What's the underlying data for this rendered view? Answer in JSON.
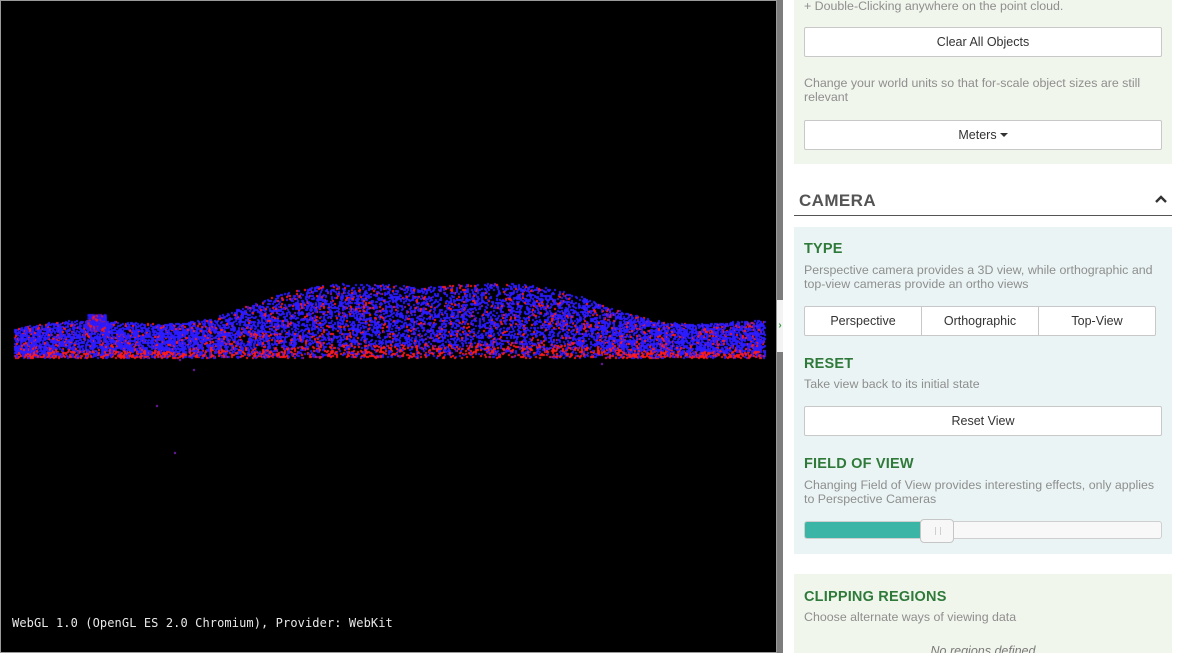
{
  "viewport": {
    "renderer_info": "WebGL 1.0 (OpenGL ES 2.0 Chromium), Provider: WebKit",
    "background_color": "#000000",
    "point_colors": [
      "#2b1bff",
      "#ff1a1a",
      "#7a1fb8"
    ]
  },
  "splitter": {
    "toggle_icon": "chevron-right-icon",
    "color": "#3a9b46"
  },
  "measurement": {
    "double_click_hint": "+ Double-Clicking anywhere on the point cloud.",
    "clear_button": "Clear All Objects",
    "units_hint": "Change your world units so that for-scale object sizes are still relevant",
    "units_dropdown": "Meters"
  },
  "camera": {
    "title": "CAMERA",
    "collapse_icon": "chevron-up-icon",
    "type": {
      "heading": "TYPE",
      "hint": "Perspective camera provides a 3D view, while orthographic and top-view cameras provide an ortho views",
      "options": [
        "Perspective",
        "Orthographic",
        "Top-View"
      ]
    },
    "reset": {
      "heading": "RESET",
      "hint": "Take view back to its initial state",
      "button": "Reset View"
    },
    "fov": {
      "heading": "FIELD OF VIEW",
      "hint": "Changing Field of View provides interesting effects, only applies to Perspective Cameras",
      "slider_fraction": 0.37,
      "fill_color": "#3bb5a5"
    }
  },
  "clipping": {
    "heading": "CLIPPING REGIONS",
    "hint": "Choose alternate ways of viewing data",
    "empty_note": "No regions defined"
  },
  "colors": {
    "heading_green": "#2f7a3a",
    "panel_green": "#f1f6ec",
    "panel_blue": "#ebf4f4"
  }
}
